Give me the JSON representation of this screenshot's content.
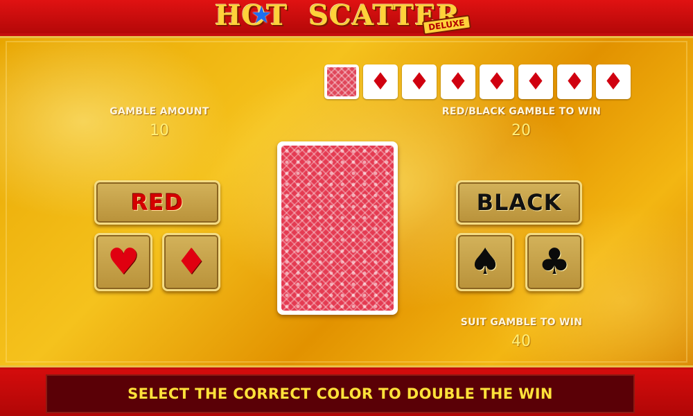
{
  "logo": {
    "word1": "HOT",
    "word2": "SCATTER",
    "badge": "DELUXE"
  },
  "gamble_amount": {
    "label": "GAMBLE AMOUNT",
    "value": "10"
  },
  "red_black": {
    "label": "RED/BLACK GAMBLE TO WIN",
    "value": "20"
  },
  "suit_gamble": {
    "label": "SUIT GAMBLE TO WIN",
    "value": "40"
  },
  "history": [
    {
      "type": "card-back",
      "symbol": ""
    },
    {
      "type": "diamond",
      "symbol": "♦"
    },
    {
      "type": "diamond",
      "symbol": "♦"
    },
    {
      "type": "diamond",
      "symbol": "♦"
    },
    {
      "type": "diamond",
      "symbol": "♦"
    },
    {
      "type": "diamond",
      "symbol": "♦"
    },
    {
      "type": "diamond",
      "symbol": "♦"
    },
    {
      "type": "diamond",
      "symbol": "♦"
    }
  ],
  "buttons": {
    "red": "RED",
    "black": "BLACK",
    "hearts": "♥",
    "diamonds": "♦",
    "spades": "♠",
    "clubs": "♣"
  },
  "message": "SELECT THE CORRECT COLOR TO DOUBLE THE WIN",
  "colors": {
    "accent_gold": "#f4dc84",
    "red": "#d40000",
    "message_yellow": "#ffe23a"
  }
}
